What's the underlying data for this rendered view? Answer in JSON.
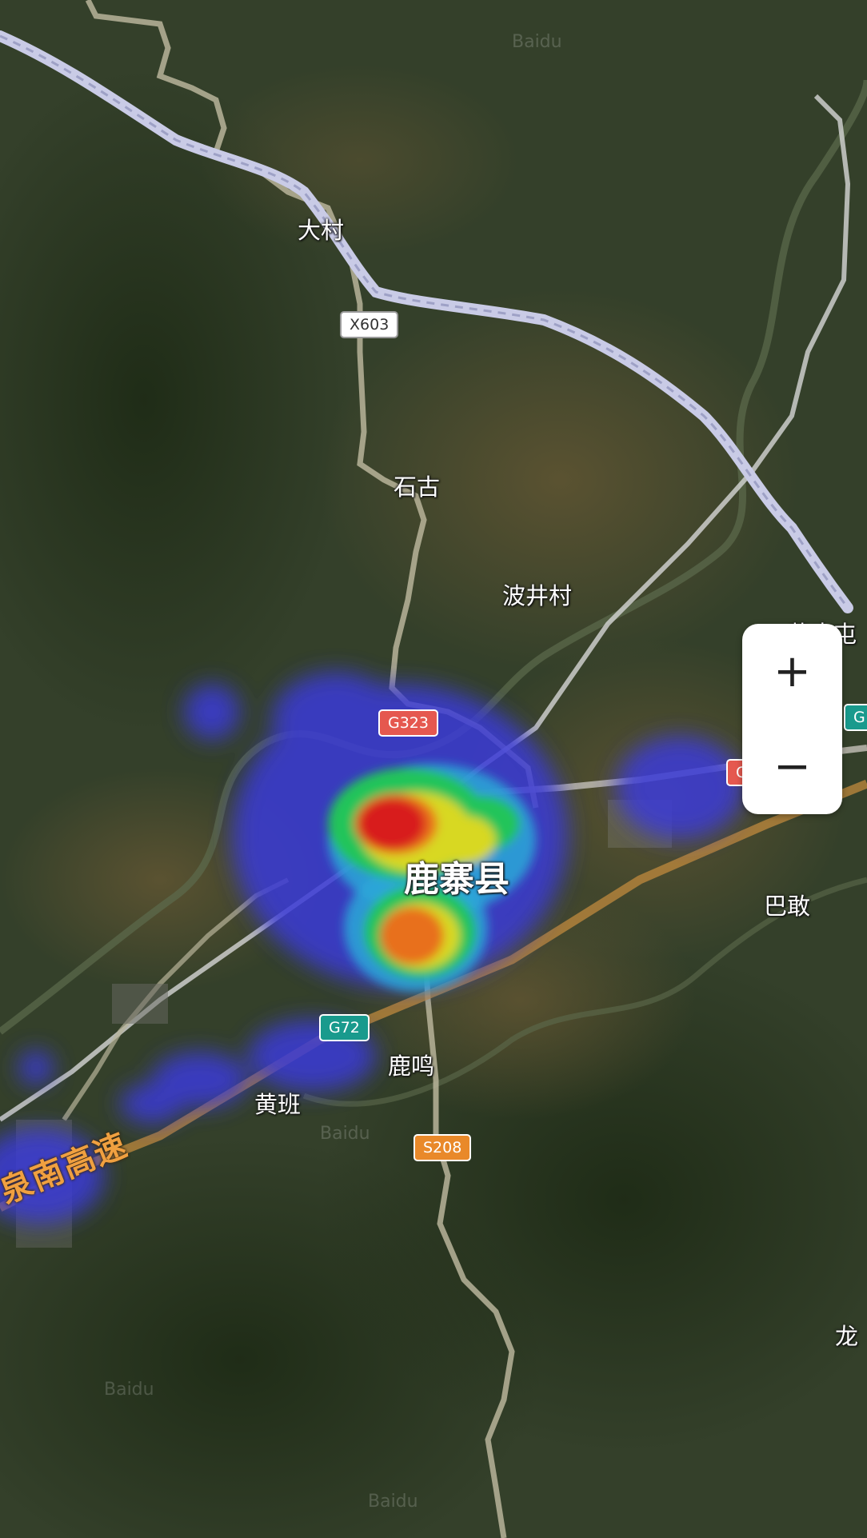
{
  "places": [
    {
      "id": "dacun",
      "name": "大村"
    },
    {
      "id": "shigu",
      "name": "石古"
    },
    {
      "id": "bojingcun",
      "name": "波井村"
    },
    {
      "id": "huangpitun",
      "name": "黄皮屯"
    },
    {
      "id": "luzhaixian",
      "name": "鹿寨县"
    },
    {
      "id": "bagan",
      "name": "巴敢"
    },
    {
      "id": "luming",
      "name": "鹿鸣"
    },
    {
      "id": "huangban",
      "name": "黄班"
    },
    {
      "id": "long",
      "name": "龙"
    }
  ],
  "road_shields": [
    {
      "id": "x603",
      "code": "X603",
      "class": "county"
    },
    {
      "id": "g323",
      "code": "G323",
      "class": "national"
    },
    {
      "id": "g323-east",
      "code": "G",
      "class": "national"
    },
    {
      "id": "g-east",
      "code": "G",
      "class": "expressway"
    },
    {
      "id": "g72",
      "code": "G72",
      "class": "expressway"
    },
    {
      "id": "s208",
      "code": "S208",
      "class": "provincial"
    }
  ],
  "highway_label": "泉南高速",
  "watermark": "Baidu",
  "zoom": {
    "in_symbol": "+",
    "out_symbol": "−"
  },
  "heatmap": {
    "gradient": [
      "#3a3ad8",
      "#2aa8d8",
      "#21c45a",
      "#d8d822",
      "#e8701a",
      "#d81a1a"
    ],
    "hotspots": [
      {
        "label": "north-west core",
        "intensity": 1.0
      },
      {
        "label": "south core",
        "intensity": 0.85
      },
      {
        "label": "north-east lobe",
        "intensity": 0.7
      }
    ]
  },
  "colors": {
    "rail": "#c9cbe6",
    "road": "#b8b49a",
    "highway": "#c08a3e",
    "terrain": "#2f3a24"
  }
}
